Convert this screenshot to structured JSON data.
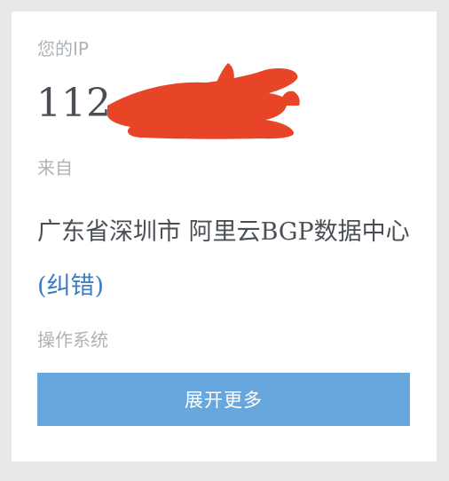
{
  "ip_section": {
    "label": "您的IP",
    "value_visible": "112."
  },
  "origin_section": {
    "label": "来自",
    "location_part1": "广东省深圳市",
    "location_part2": "阿里云BGP数据中心",
    "correction_link": "(纠错)"
  },
  "os_section": {
    "label": "操作系统"
  },
  "expand_button": {
    "label": "展开更多"
  },
  "colors": {
    "page_bg": "#e8e8e8",
    "card_bg": "#ffffff",
    "label_gray": "#aeb3b8",
    "text_dark": "#4a4f55",
    "link_blue": "#3f7dc0",
    "button_blue": "#68a7dd",
    "redaction_red": "#e84427"
  }
}
